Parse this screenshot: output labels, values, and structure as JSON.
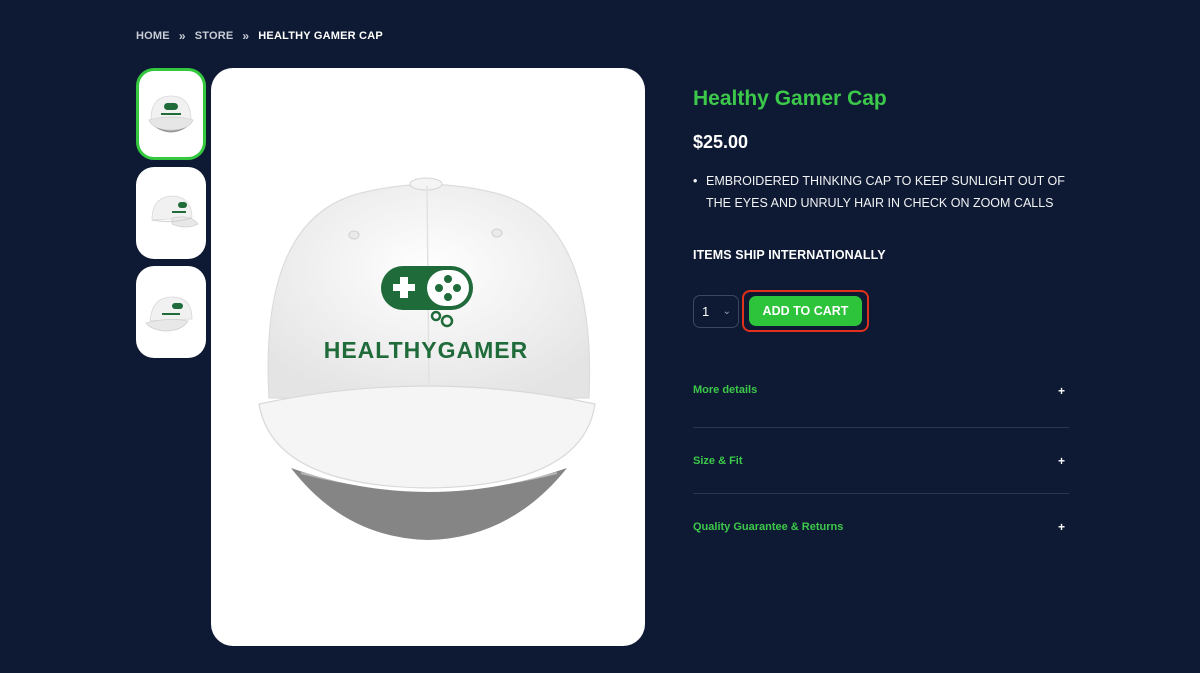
{
  "breadcrumb": {
    "items": [
      "HOME",
      "STORE",
      "HEALTHY GAMER CAP"
    ],
    "separator": "»"
  },
  "gallery": {
    "thumbnails": [
      {
        "name": "thumbnail-front",
        "active": true
      },
      {
        "name": "thumbnail-side",
        "active": false
      },
      {
        "name": "thumbnail-angle",
        "active": false
      }
    ],
    "logo_text": "HEALTHYGAMER"
  },
  "product": {
    "title": "Healthy Gamer Cap",
    "price": "$25.00",
    "description": "EMBROIDERED THINKING CAP TO KEEP SUNLIGHT OUT OF THE EYES AND UNRULY HAIR IN CHECK ON ZOOM CALLS",
    "shipping_note": "ITEMS SHIP INTERNATIONALLY",
    "quantity": "1",
    "add_to_cart_label": "ADD TO CART"
  },
  "accordion": [
    {
      "label": "More details",
      "icon": "+"
    },
    {
      "label": "Size & Fit",
      "icon": "+"
    },
    {
      "label": "Quality Guarantee & Returns",
      "icon": "+"
    }
  ],
  "colors": {
    "background": "#0e1a33",
    "accent_green": "#3cc84a",
    "button_green": "#2dc33a",
    "highlight_red": "#e1301c",
    "logo_green": "#1f6b3a"
  }
}
